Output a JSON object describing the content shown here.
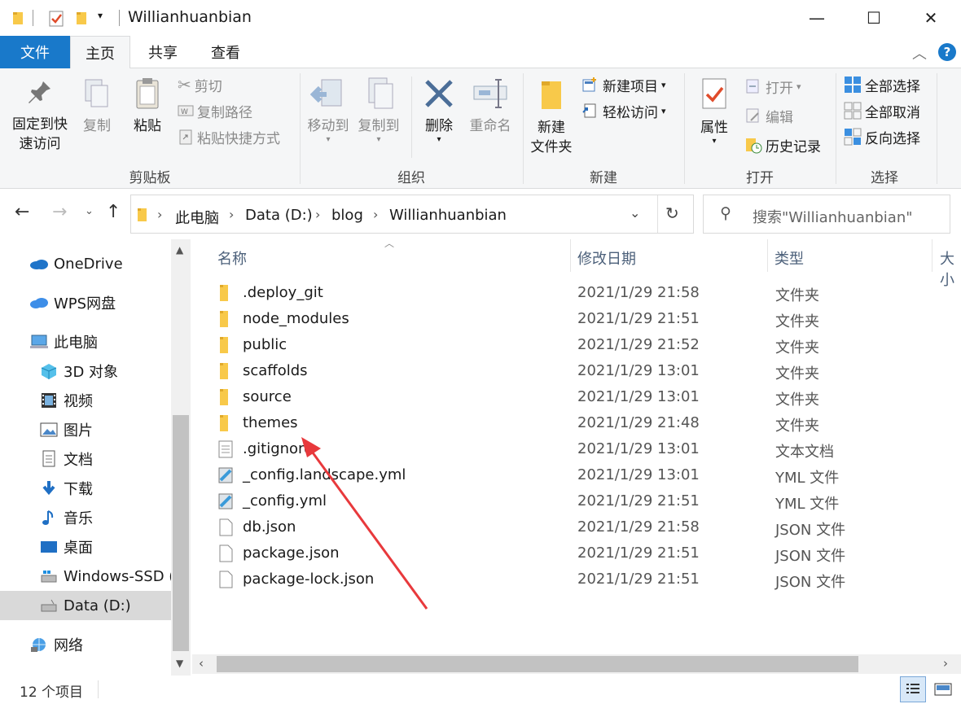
{
  "window": {
    "title": "Willianhuanbian",
    "controls": {
      "minimize": "—",
      "maximize": "☐",
      "close": "✕"
    }
  },
  "tabs": [
    {
      "label": "文件"
    },
    {
      "label": "主页"
    },
    {
      "label": "共享"
    },
    {
      "label": "查看"
    }
  ],
  "ribbon": {
    "clipboard": {
      "label": "剪贴板",
      "pin_line1": "固定到快",
      "pin_line2": "速访问",
      "copy": "复制",
      "paste": "粘贴",
      "cut": "剪切",
      "copy_path": "复制路径",
      "paste_shortcut": "粘贴快捷方式"
    },
    "organize": {
      "label": "组织",
      "move_to": "移动到",
      "copy_to": "复制到",
      "delete": "删除",
      "rename": "重命名"
    },
    "new": {
      "label": "新建",
      "new_folder_line1": "新建",
      "new_folder_line2": "文件夹",
      "new_item": "新建项目",
      "easy_access": "轻松访问"
    },
    "open": {
      "label": "打开",
      "properties": "属性",
      "open": "打开",
      "edit": "编辑",
      "history": "历史记录"
    },
    "select": {
      "label": "选择",
      "select_all": "全部选择",
      "select_none": "全部取消",
      "invert": "反向选择"
    }
  },
  "address": {
    "crumbs": [
      "此电脑",
      "Data (D:)",
      "blog",
      "Willianhuanbian"
    ],
    "search_placeholder": "搜索\"Willianhuanbian\""
  },
  "nav": [
    {
      "label": "OneDrive",
      "icon": "cloud-icon",
      "level": 0
    },
    {
      "label": "WPS网盘",
      "icon": "wps-cloud-icon",
      "level": 0
    },
    {
      "label": "此电脑",
      "icon": "computer-icon",
      "level": 0
    },
    {
      "label": "3D 对象",
      "icon": "cube-icon",
      "level": 1
    },
    {
      "label": "视频",
      "icon": "video-icon",
      "level": 1
    },
    {
      "label": "图片",
      "icon": "picture-icon",
      "level": 1
    },
    {
      "label": "文档",
      "icon": "document-icon",
      "level": 1
    },
    {
      "label": "下载",
      "icon": "download-icon",
      "level": 1
    },
    {
      "label": "音乐",
      "icon": "music-icon",
      "level": 1
    },
    {
      "label": "桌面",
      "icon": "desktop-icon",
      "level": 1
    },
    {
      "label": "Windows-SSD (",
      "icon": "drive-icon",
      "level": 1
    },
    {
      "label": "Data (D:)",
      "icon": "drive-icon",
      "level": 1,
      "selected": true
    },
    {
      "label": "网络",
      "icon": "network-icon",
      "level": 0
    }
  ],
  "columns": {
    "name": "名称",
    "date": "修改日期",
    "type": "类型",
    "size": "大小"
  },
  "files": [
    {
      "name": ".deploy_git",
      "date": "2021/1/29 21:58",
      "type": "文件夹",
      "icon": "folder-icon"
    },
    {
      "name": "node_modules",
      "date": "2021/1/29 21:51",
      "type": "文件夹",
      "icon": "folder-icon"
    },
    {
      "name": "public",
      "date": "2021/1/29 21:52",
      "type": "文件夹",
      "icon": "folder-icon"
    },
    {
      "name": "scaffolds",
      "date": "2021/1/29 13:01",
      "type": "文件夹",
      "icon": "folder-icon"
    },
    {
      "name": "source",
      "date": "2021/1/29 13:01",
      "type": "文件夹",
      "icon": "folder-icon"
    },
    {
      "name": "themes",
      "date": "2021/1/29 21:48",
      "type": "文件夹",
      "icon": "folder-icon"
    },
    {
      "name": ".gitignore",
      "date": "2021/1/29 13:01",
      "type": "文本文档",
      "icon": "text-file-icon"
    },
    {
      "name": "_config.landscape.yml",
      "date": "2021/1/29 13:01",
      "type": "YML 文件",
      "icon": "yml-file-icon"
    },
    {
      "name": "_config.yml",
      "date": "2021/1/29 21:51",
      "type": "YML 文件",
      "icon": "yml-file-icon"
    },
    {
      "name": "db.json",
      "date": "2021/1/29 21:58",
      "type": "JSON 文件",
      "icon": "file-icon"
    },
    {
      "name": "package.json",
      "date": "2021/1/29 21:51",
      "type": "JSON 文件",
      "icon": "file-icon"
    },
    {
      "name": "package-lock.json",
      "date": "2021/1/29 21:51",
      "type": "JSON 文件",
      "icon": "file-icon"
    }
  ],
  "status": {
    "item_count": "12 个项目"
  },
  "colors": {
    "accent": "#1979ca",
    "folder": "#f8c94a",
    "annotation_arrow": "#e8393c"
  }
}
